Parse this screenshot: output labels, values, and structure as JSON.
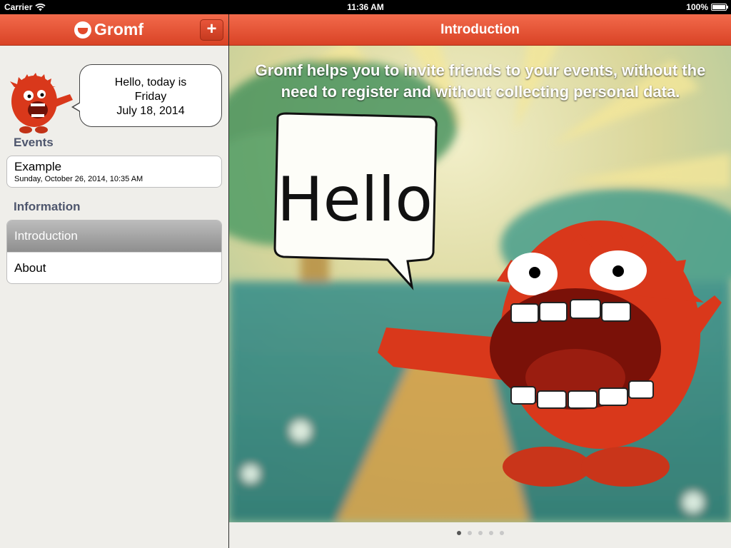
{
  "status_bar": {
    "carrier": "Carrier",
    "time": "11:36 AM",
    "battery": "100%",
    "battery_level": 1.0
  },
  "master": {
    "app_name": "Gromf",
    "add_label": "+",
    "greeting": {
      "line1": "Hello, today is",
      "line2": "Friday",
      "line3": "July 18, 2014"
    },
    "events": {
      "header": "Events",
      "items": [
        {
          "title": "Example",
          "date": "Sunday, October 26, 2014, 10:35 AM"
        }
      ]
    },
    "information": {
      "header": "Information",
      "items": [
        {
          "label": "Introduction",
          "selected": true
        },
        {
          "label": "About",
          "selected": false
        }
      ]
    }
  },
  "detail": {
    "title": "Introduction",
    "intro_text": "Gromf helps you to invite friends to your events, without the need to register and without collecting personal data.",
    "bubble_text": "Hello",
    "page_count": 5,
    "current_page": 1
  },
  "colors": {
    "nav_bar": "#e2492b",
    "mascot": "#d9381b",
    "sidebar_bg": "#efeeea",
    "section_header": "#4e566d"
  },
  "icons": [
    "wifi-icon",
    "battery-icon",
    "gromf-logo-icon",
    "plus-icon",
    "mascot-image",
    "hello-speech-bubble"
  ]
}
